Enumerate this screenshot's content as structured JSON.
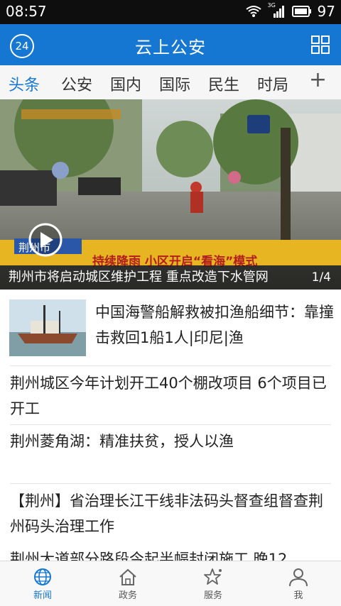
{
  "status_bar": {
    "time": "08:57",
    "network": "3G",
    "battery": "97"
  },
  "app_bar": {
    "title": "云上公安",
    "weather_badge": "24"
  },
  "tabs": [
    {
      "label": "头条",
      "active": true
    },
    {
      "label": "公安",
      "active": false
    },
    {
      "label": "国内",
      "active": false
    },
    {
      "label": "国际",
      "active": false
    },
    {
      "label": "民生",
      "active": false
    },
    {
      "label": "时局",
      "active": false
    }
  ],
  "tab_add": "+",
  "hero": {
    "caption": "荆州市将启动城区维护工程 重点改造下水管网",
    "pager": "1/4",
    "video_banner": "持续降雨 小区开启“看海”模式",
    "location_tag": "荆州市"
  },
  "news": [
    {
      "title": "中国海警船解救被扣渔船细节：靠撞击救回1船1人|印尼|渔",
      "thumbnail": "fishing-boat-photo"
    },
    {
      "title": "荆州城区今年计划开工40个棚改项目 6个项目已开工"
    },
    {
      "title": "荆州菱角湖：精准扶贫，授人以渔"
    },
    {
      "title": "【荆州】省治理长江干线非法码头督查组督查荆州码头治理工作"
    },
    {
      "title": "荆州大道部分路段今起半幅封闭施工 晚12"
    }
  ],
  "bottom_nav": [
    {
      "label": "新闻",
      "icon": "globe-icon",
      "active": true
    },
    {
      "label": "政务",
      "icon": "home-icon",
      "active": false
    },
    {
      "label": "服务",
      "icon": "star-icon",
      "active": false
    },
    {
      "label": "我",
      "icon": "user-icon",
      "active": false
    }
  ],
  "colors": {
    "brand": "#1677d2",
    "status_bar": "#0e0e0e",
    "tab_bg": "#f6f6f6"
  }
}
